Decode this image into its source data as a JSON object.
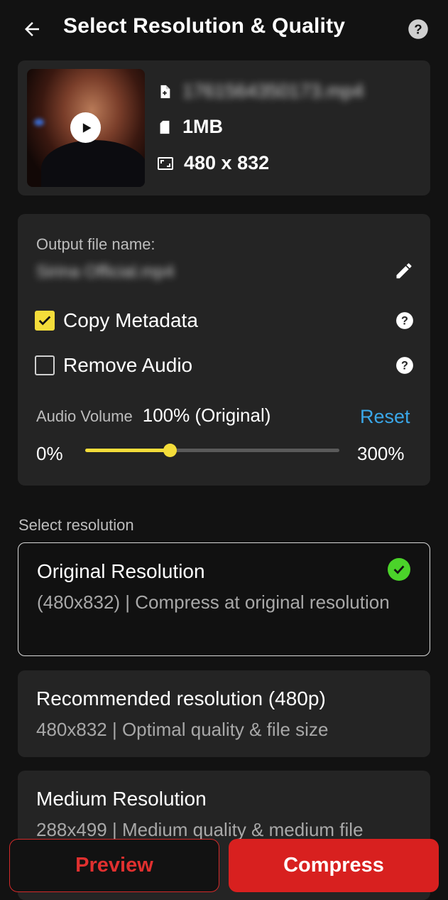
{
  "header": {
    "title": "Select Resolution & Quality"
  },
  "file": {
    "name": "1761564350173.mp4",
    "size": "1MB",
    "dimensions": "480 x 832"
  },
  "options": {
    "output_label": "Output file name:",
    "output_name": "Sirina Official.mp4",
    "copy_metadata_label": "Copy Metadata",
    "copy_metadata_checked": true,
    "remove_audio_label": "Remove Audio",
    "remove_audio_checked": false,
    "volume_label": "Audio Volume",
    "volume_value": "100% (Original)",
    "volume_percent": 100,
    "volume_max": 300,
    "reset_label": "Reset",
    "slider_min": "0%",
    "slider_max": "300%"
  },
  "resolution": {
    "section_label": "Select resolution",
    "items": [
      {
        "title": "Original Resolution",
        "desc": "(480x832) | Compress at original resolution",
        "selected": true
      },
      {
        "title": "Recommended resolution (480p)",
        "desc": "480x832 | Optimal quality & file size",
        "selected": false
      },
      {
        "title": "Medium Resolution",
        "desc": "288x499 | Medium quality & medium file",
        "selected": false
      }
    ]
  },
  "actions": {
    "preview_label": "Preview",
    "compress_label": "Compress"
  },
  "colors": {
    "accent_yellow": "#f4dd3a",
    "accent_red": "#d8201f",
    "link_blue": "#3aa7e8",
    "success_green": "#4bd32a"
  }
}
